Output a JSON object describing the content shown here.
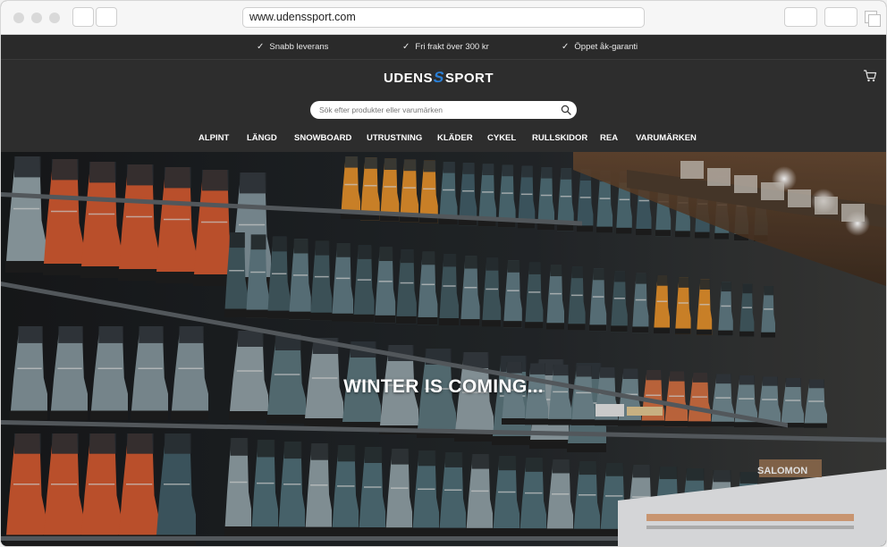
{
  "browser": {
    "url": "www.udenssport.com"
  },
  "usp_bar": {
    "items": [
      {
        "label": "Snabb leverans"
      },
      {
        "label": "Fri frakt över 300 kr"
      },
      {
        "label": "Öppet åk-garanti"
      }
    ]
  },
  "header": {
    "logo_left": "UDENS",
    "logo_mark": "S",
    "logo_right": "SPORT",
    "cart_icon": "shopping-cart-icon",
    "search": {
      "placeholder": "Sök efter produkter eller varumärken",
      "icon": "search-icon"
    }
  },
  "nav": {
    "items": [
      {
        "label": "ALPINT"
      },
      {
        "label": "LÄNGD"
      },
      {
        "label": "SNOWBOARD"
      },
      {
        "label": "UTRUSTNING"
      },
      {
        "label": "KLÄDER"
      },
      {
        "label": "CYKEL"
      },
      {
        "label": "RULLSKIDOR"
      },
      {
        "label": "REA"
      },
      {
        "label": "VARUMÄRKEN"
      }
    ]
  },
  "hero": {
    "title": "WINTER IS COMING...",
    "box_label": "SALOMON"
  },
  "colors": {
    "header_bg": "#2d2d2d",
    "logo_accent": "#2a7fd6",
    "boot_orange": "#c9562f",
    "boot_teal": "#4c6a72"
  }
}
